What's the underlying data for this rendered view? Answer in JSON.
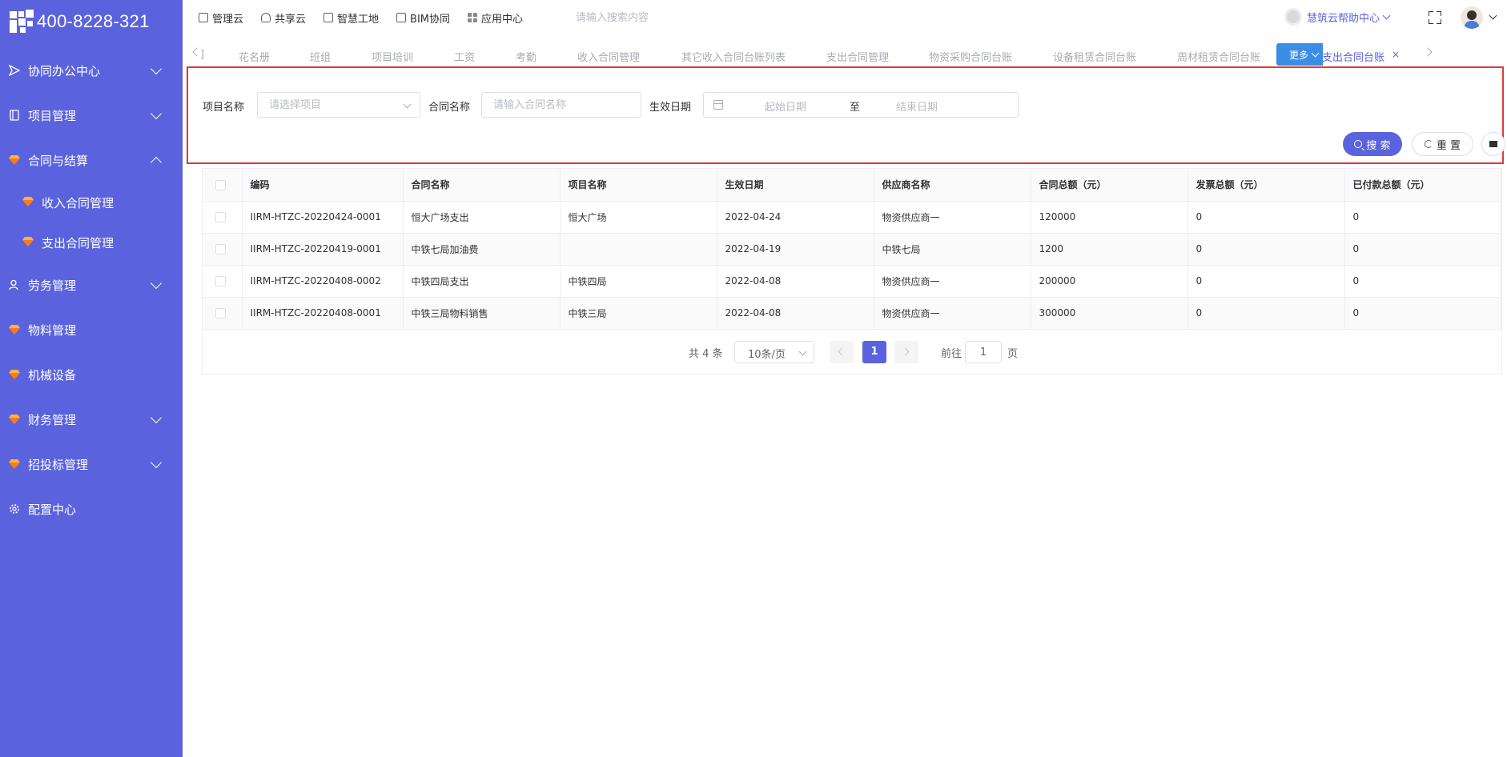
{
  "logo": {
    "text": "400-8228-321"
  },
  "sidebar": {
    "items": [
      {
        "label": "协同办公中心",
        "icon": "send-icon",
        "expanded": false,
        "has_children": true
      },
      {
        "label": "项目管理",
        "icon": "book-icon",
        "expanded": false,
        "has_children": true
      },
      {
        "label": "合同与结算",
        "icon": "gem-icon",
        "expanded": true,
        "has_children": true,
        "children": [
          {
            "label": "收入合同管理",
            "icon": "gem-icon"
          },
          {
            "label": "支出合同管理",
            "icon": "gem-icon"
          }
        ]
      },
      {
        "label": "劳务管理",
        "icon": "user-icon",
        "expanded": false,
        "has_children": true
      },
      {
        "label": "物料管理",
        "icon": "gem-icon",
        "has_children": false
      },
      {
        "label": "机械设备",
        "icon": "gem-icon",
        "has_children": false
      },
      {
        "label": "财务管理",
        "icon": "gem-icon",
        "expanded": false,
        "has_children": true
      },
      {
        "label": "招投标管理",
        "icon": "gem-icon",
        "expanded": false,
        "has_children": true
      },
      {
        "label": "配置中心",
        "icon": "gear-icon",
        "has_children": false
      }
    ]
  },
  "topbar": {
    "nav": [
      "管理云",
      "共享云",
      "智慧工地",
      "BIM协同",
      "应用中心"
    ],
    "search_placeholder": "请输入搜索内容",
    "help_label": "慧筑云帮助中心"
  },
  "tabs": {
    "items": [
      "花名册",
      "班组",
      "项目培训",
      "工资",
      "考勤",
      "收入合同管理",
      "其它收入合同台账列表",
      "支出合同管理",
      "物资采购合同台账",
      "设备租赁合同台账",
      "周材租赁合同台账",
      "其它支出合同台账"
    ],
    "active": "其它支出合同台账",
    "close_symbol": "×",
    "more_label": "更多"
  },
  "filter": {
    "project_label": "项目名称",
    "project_placeholder": "请选择项目",
    "contract_label": "合同名称",
    "contract_placeholder": "请输入合同名称",
    "date_label": "生效日期",
    "date_start_placeholder": "起始日期",
    "date_separator": "至",
    "date_end_placeholder": "结束日期",
    "search_label": "搜 索",
    "reset_label": "重 置"
  },
  "table": {
    "columns": [
      "编码",
      "合同名称",
      "项目名称",
      "生效日期",
      "供应商名称",
      "合同总额（元）",
      "发票总额（元）",
      "已付款总额（元）"
    ],
    "rows": [
      [
        "IIRM-HTZC-20220424-0001",
        "恒大广场支出",
        "恒大广场",
        "2022-04-24",
        "物资供应商一",
        "120000",
        "0",
        "0"
      ],
      [
        "IIRM-HTZC-20220419-0001",
        "中铁七局加油费",
        "",
        "2022-04-19",
        "中铁七局",
        "1200",
        "0",
        "0"
      ],
      [
        "IIRM-HTZC-20220408-0002",
        "中铁四局支出",
        "中铁四局",
        "2022-04-08",
        "物资供应商一",
        "200000",
        "0",
        "0"
      ],
      [
        "IIRM-HTZC-20220408-0001",
        "中铁三局物料销售",
        "中铁三局",
        "2022-04-08",
        "物资供应商一",
        "300000",
        "0",
        "0"
      ]
    ]
  },
  "pagination": {
    "total_text": "共 4 条",
    "page_size": "10条/页",
    "current_page": "1",
    "goto_label": "前往",
    "goto_value": "1",
    "page_suffix": "页"
  },
  "colors": {
    "sidebar_bg": "#5a63dd",
    "accent": "#5a63dd",
    "highlight_border": "#e03838",
    "more_button": "#3a8ee6"
  }
}
